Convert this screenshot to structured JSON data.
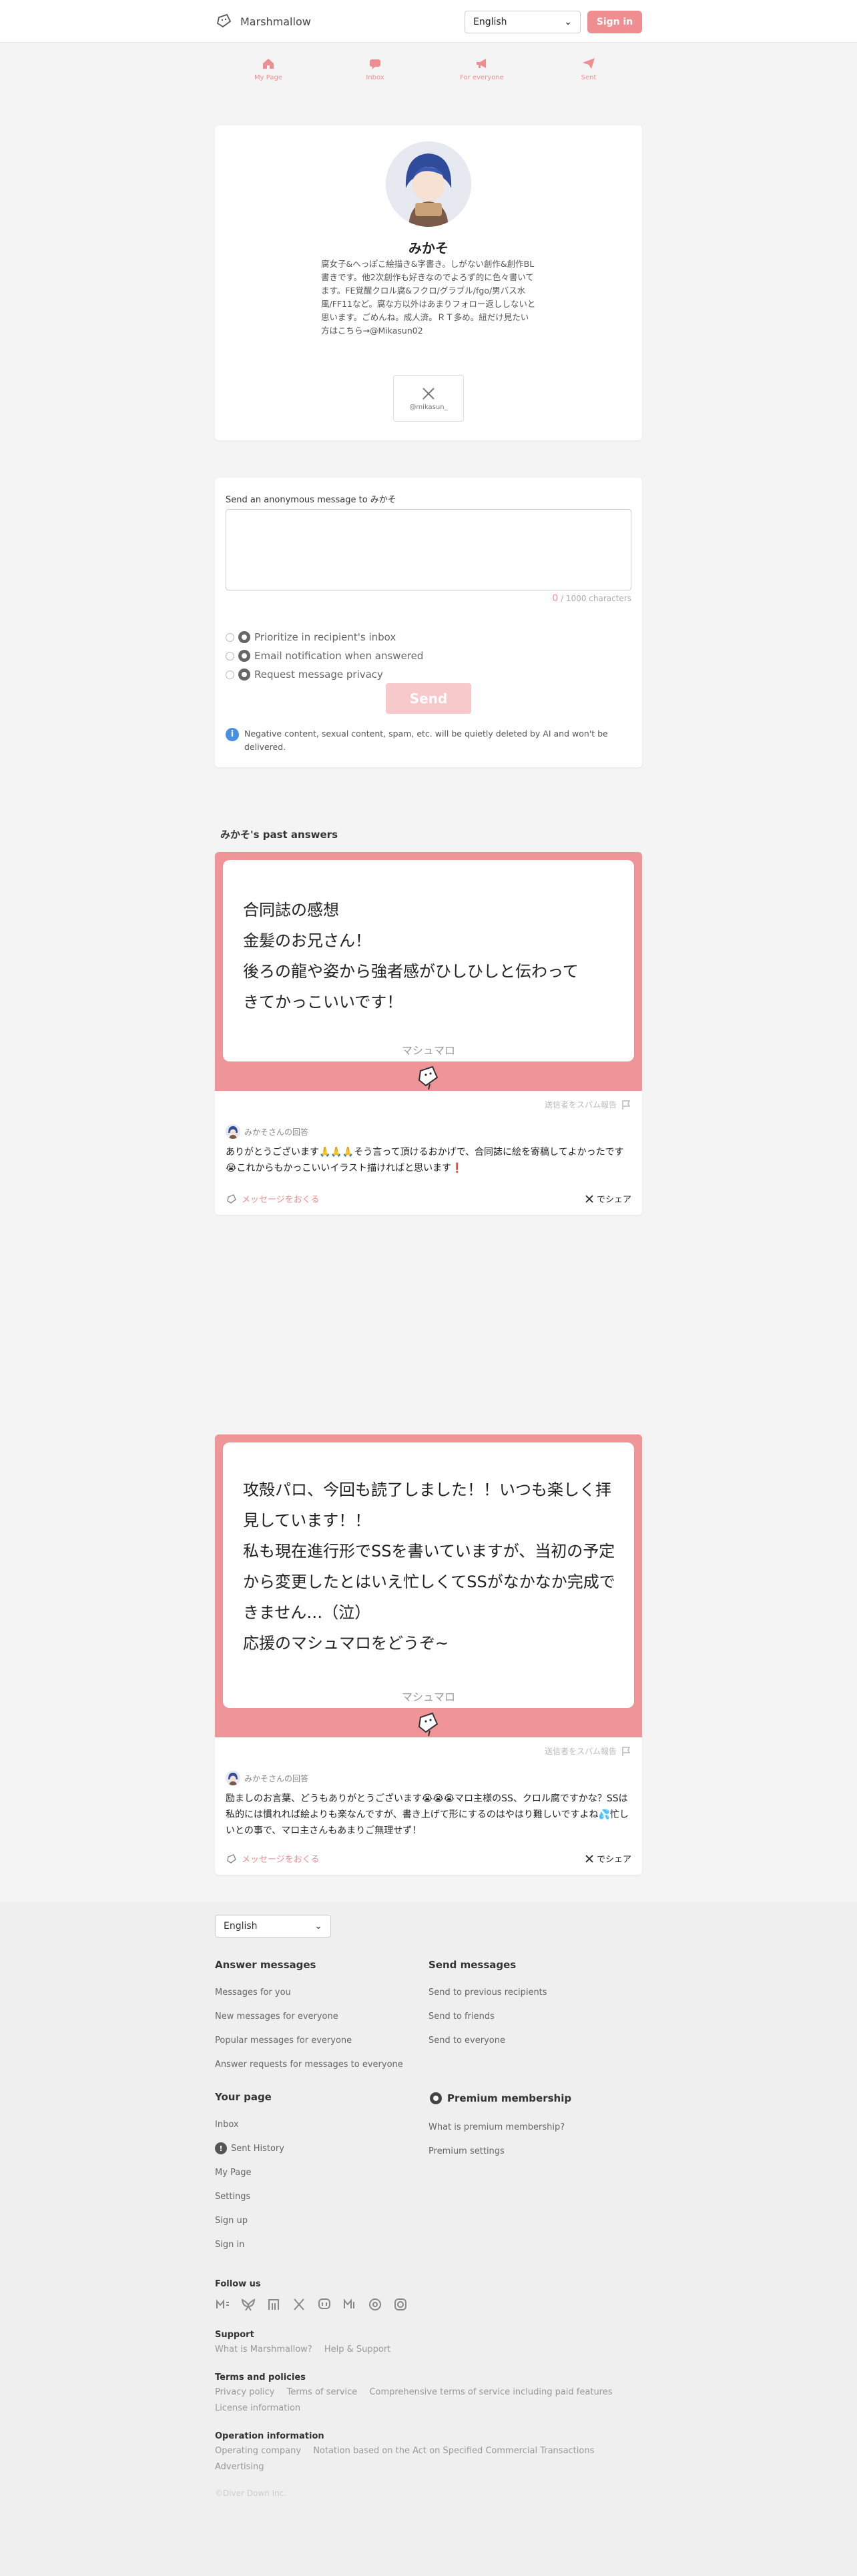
{
  "header": {
    "app_name": "Marshmallow",
    "language": "English",
    "signin_label": "Sign in"
  },
  "nav": {
    "tabs": [
      {
        "label": "My Page",
        "icon": "home-icon"
      },
      {
        "label": "Inbox",
        "icon": "inbox-icon"
      },
      {
        "label": "For everyone",
        "icon": "megaphone-icon"
      },
      {
        "label": "Sent",
        "icon": "paper-plane-icon"
      }
    ]
  },
  "profile": {
    "name": "みかそ",
    "bio": "腐女子&へっぽこ絵描き&字書き。しがない創作&創作BL書きです。他2次創作も好きなのでよろず的に色々書いてます。FE覚醒クロル腐&フクロ/グラブル/fgo/男バス水風/FF11など。腐な方以外はあまりフォロー返ししないと思います。ごめんね。成人済。ＲＴ多め。紐だけ見たい方はこちら→@Mikasun02",
    "x_handle": "@mikasun_"
  },
  "form": {
    "label": "Send an anonymous message to みかそ",
    "char_count": "0",
    "char_limit": "/ 1000 characters",
    "options": [
      "Prioritize in recipient's inbox",
      "Email notification when answered",
      "Request message privacy"
    ],
    "send_label": "Send",
    "notice": "Negative content, sexual content, spam, etc. will be quietly deleted by AI and won't be delivered."
  },
  "answers_section": {
    "title": "みかそ's past answers"
  },
  "answers": [
    {
      "message": "合同誌の感想\n金髪のお兄さん！\n後ろの龍や姿から強者感がひしひしと伝わって\nきてかっこいいです！",
      "brand": "マシュマロ",
      "report": "送信者をスパム報告",
      "responder": "みかそさんの回答",
      "reply": "ありがとうございます🙏🙏🙏そう言って頂けるおかげで、合同誌に絵を寄稿してよかったです😭これからもかっこいいイラスト描ければと思います❗",
      "more_label": "メッセージをおくる",
      "share_label": "でシェア"
    },
    {
      "message": "攻殻パロ、今回も読了しました！！いつも楽しく拝見しています！！\n私も現在進行形でSSを書いていますが、当初の予定から変更したとはいえ忙しくてSSがなかなか完成できません…（泣）\n応援のマシュマロをどうぞ~",
      "brand": "マシュマロ",
      "report": "送信者をスパム報告",
      "responder": "みかそさんの回答",
      "reply": "励ましのお言葉、どうもありがとうございます😭😭😭マロ主様のSS、クロル腐ですかな？SSは私的には慣れれば絵よりも楽なんですが、書き上げて形にするのはやはり難しいですよね💦忙しいとの事で、マロ主さんもあまりご無理せず！",
      "more_label": "メッセージをおくる",
      "share_label": "でシェア"
    }
  ],
  "footer": {
    "language": "English",
    "answer_heading": "Answer messages",
    "answer_links": [
      "Messages for you",
      "New messages for everyone",
      "Popular messages for everyone",
      "Answer requests for messages to everyone"
    ],
    "send_heading": "Send messages",
    "send_links": [
      "Send to previous recipients",
      "Send to friends",
      "Send to everyone"
    ],
    "page_heading": "Your page",
    "page_links": [
      "Inbox",
      "Sent History",
      "My Page",
      "Settings",
      "Sign up",
      "Sign in"
    ],
    "premium_heading": "Premium membership",
    "premium_links": [
      "What is premium membership?",
      "Premium settings"
    ],
    "follow_heading": "Follow us",
    "social_icons": [
      "misskey-icon",
      "bluesky-icon",
      "note-icon",
      "x-icon",
      "mastodon-icon",
      "misskey-io-icon",
      "threads-icon",
      "instagram-icon"
    ],
    "support_heading": "Support",
    "support_links": [
      "What is Marshmallow?",
      "Help & Support"
    ],
    "terms_heading": "Terms and policies",
    "terms_links": [
      "Privacy policy",
      "Terms of service",
      "Comprehensive terms of service including paid features",
      "License information"
    ],
    "ops_heading": "Operation information",
    "ops_links": [
      "Operating company",
      "Notation based on the Act on Specified Commercial Transactions",
      "Advertising"
    ],
    "copyright": "©Diver Down Inc."
  },
  "colors": {
    "accent": "#ef8d90",
    "card_pink": "#ef9497",
    "page_bg": "#f4f4f4"
  }
}
